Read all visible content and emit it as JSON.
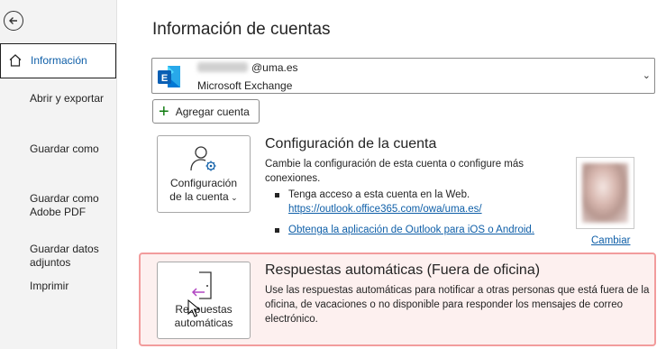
{
  "sidebar": {
    "items": [
      {
        "label": "Información"
      },
      {
        "label": "Abrir y exportar"
      },
      {
        "label": "Guardar como"
      },
      {
        "label": "Guardar como\nAdobe PDF"
      },
      {
        "label": "Guardar datos\nadjuntos"
      },
      {
        "label": "Imprimir"
      }
    ]
  },
  "main": {
    "title": "Información de cuentas",
    "account": {
      "email_suffix": "@uma.es",
      "type": "Microsoft Exchange",
      "logo_letter": "E"
    },
    "add_account_label": "Agregar cuenta",
    "account_settings": {
      "button_label_line1": "Configuración",
      "button_label_line2": "de la cuenta",
      "title": "Configuración de la cuenta",
      "description": "Cambie la configuración de esta cuenta o configure más conexiones.",
      "bullet1_text": "Tenga acceso a esta cuenta en la Web.",
      "bullet1_link": "https://outlook.office365.com/owa/uma.es/",
      "bullet2_link": "Obtenga la aplicación de Outlook para iOS o Android.",
      "change_photo_label": "Cambiar"
    },
    "auto_replies": {
      "button_label_line1": "Respuestas",
      "button_label_line2": "automáticas",
      "title": "Respuestas automáticas (Fuera de oficina)",
      "description": "Use las respuestas automáticas para notificar a otras personas que está fuera de la oficina, de vacaciones o no disponible para responder los mensajes de correo electrónico."
    }
  },
  "colors": {
    "accent_link": "#0f5fa8",
    "highlight_border": "#f29c9c",
    "exchange_blue": "#0a5fb4"
  }
}
